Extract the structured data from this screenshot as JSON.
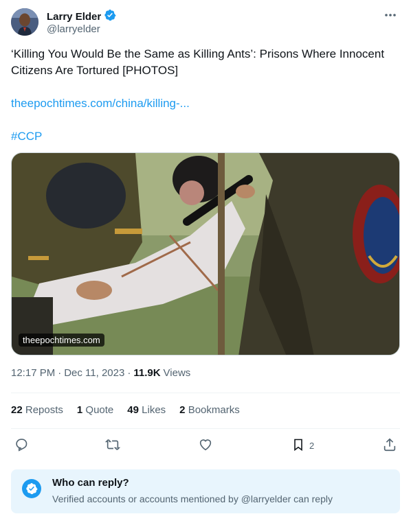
{
  "author": {
    "display_name": "Larry Elder",
    "handle": "@larryelder",
    "verified": true
  },
  "tweet": {
    "text": "‘Killing You Would Be the Same as Killing Ants’: Prisons Where Innocent Citizens Are Tortured [PHOTOS]",
    "link": "theepochtimes.com/china/killing-...",
    "hashtag": "#CCP",
    "media_badge": "theepochtimes.com"
  },
  "meta": {
    "time": "12:17 PM",
    "separator": "·",
    "date": "Dec 11, 2023",
    "views_count": "11.9K",
    "views_label": "Views"
  },
  "stats": {
    "reposts_count": "22",
    "reposts_label": "Reposts",
    "quotes_count": "1",
    "quotes_label": "Quote",
    "likes_count": "49",
    "likes_label": "Likes",
    "bookmarks_count": "2",
    "bookmarks_label": "Bookmarks"
  },
  "actions": {
    "bookmark_count": "2"
  },
  "reply_restriction": {
    "title": "Who can reply?",
    "subtitle": "Verified accounts or accounts mentioned by @larryelder can reply"
  },
  "colors": {
    "accent": "#1d9bf0",
    "text_primary": "#0f1419",
    "text_secondary": "#536471",
    "reply_box_bg": "#e8f5fd"
  },
  "icons": [
    "verified-badge-icon",
    "more-icon",
    "reply-icon",
    "repost-icon",
    "like-icon",
    "bookmark-icon",
    "share-icon",
    "check-badge-icon"
  ]
}
